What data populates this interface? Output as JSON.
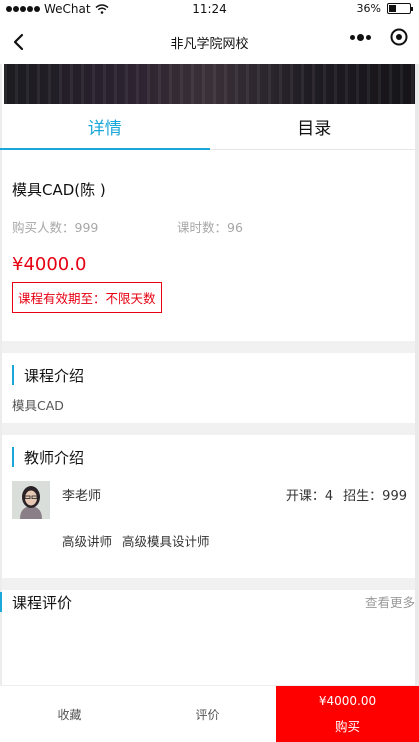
{
  "status_bar": {
    "carrier": "WeChat",
    "time": "11:24",
    "battery": "36%",
    "battery_level": 0.36
  },
  "nav": {
    "title": "非凡学院网校"
  },
  "tabs": [
    {
      "label": "详情",
      "active": true
    },
    {
      "label": "目录",
      "active": false
    }
  ],
  "course": {
    "title": "模具CAD(陈 )",
    "buyers": "购买人数：999",
    "lessons": "课时数：96",
    "price": "¥4000.0",
    "validity": "课程有效期至：不限天数"
  },
  "intro": {
    "title": "课程介绍",
    "text": "模具CAD"
  },
  "teacher": {
    "section_title": "教师介绍",
    "name": "李老师",
    "courses": "开课：4",
    "students": "招生：999",
    "titles": [
      "高级讲师",
      "高级模具设计师"
    ]
  },
  "reviews": {
    "title": "课程评价",
    "more": "查看更多"
  },
  "bottom_bar": {
    "favorite": "收藏",
    "review": "评价",
    "buy_price": "¥4000.00",
    "buy_label": "购买"
  },
  "colors": {
    "accent": "#1aa7d9",
    "price_red": "#e60012",
    "buy_red": "#ff0000"
  }
}
